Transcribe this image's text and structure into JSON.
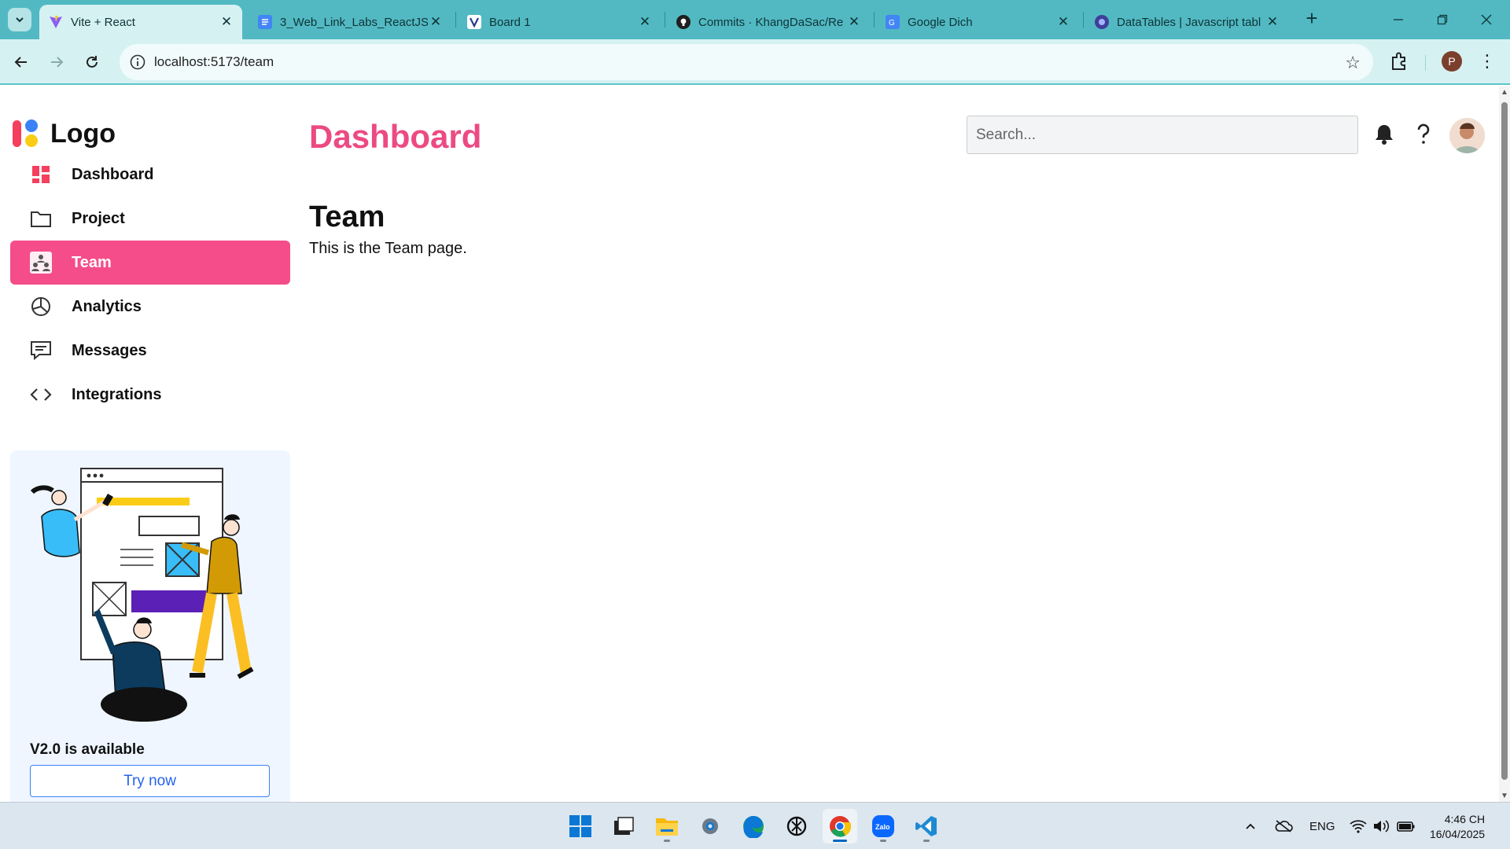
{
  "browser": {
    "tabs": [
      {
        "title": "Vite + React",
        "active": true
      },
      {
        "title": "3_Web_Link_Labs_ReactJS_",
        "active": false
      },
      {
        "title": "Board 1",
        "active": false
      },
      {
        "title": "Commits · KhangDaSac/Re",
        "active": false
      },
      {
        "title": "Google Dich",
        "active": false
      },
      {
        "title": "DataTables | Javascript tabl",
        "active": false
      }
    ],
    "url": "localhost:5173/team",
    "profile_initial": "P"
  },
  "app": {
    "logo_text": "Logo",
    "header_title": "Dashboard",
    "search_placeholder": "Search...",
    "nav": [
      {
        "label": "Dashboard",
        "icon": "dashboard-grid-icon",
        "active": false
      },
      {
        "label": "Project",
        "icon": "folder-icon",
        "active": false
      },
      {
        "label": "Team",
        "icon": "team-icon",
        "active": true
      },
      {
        "label": "Analytics",
        "icon": "pie-chart-icon",
        "active": false
      },
      {
        "label": "Messages",
        "icon": "message-icon",
        "active": false
      },
      {
        "label": "Integrations",
        "icon": "code-icon",
        "active": false
      }
    ],
    "promo": {
      "title": "V2.0 is available",
      "button": "Try now"
    },
    "content": {
      "heading": "Team",
      "text": "This is the Team page."
    }
  },
  "taskbar": {
    "language": "ENG",
    "time": "4:46 CH",
    "date": "16/04/2025"
  },
  "colors": {
    "accent": "#f44d89",
    "title": "#ec4a83",
    "chrome": "#52b9c2",
    "promo_bg": "#eff6ff"
  }
}
